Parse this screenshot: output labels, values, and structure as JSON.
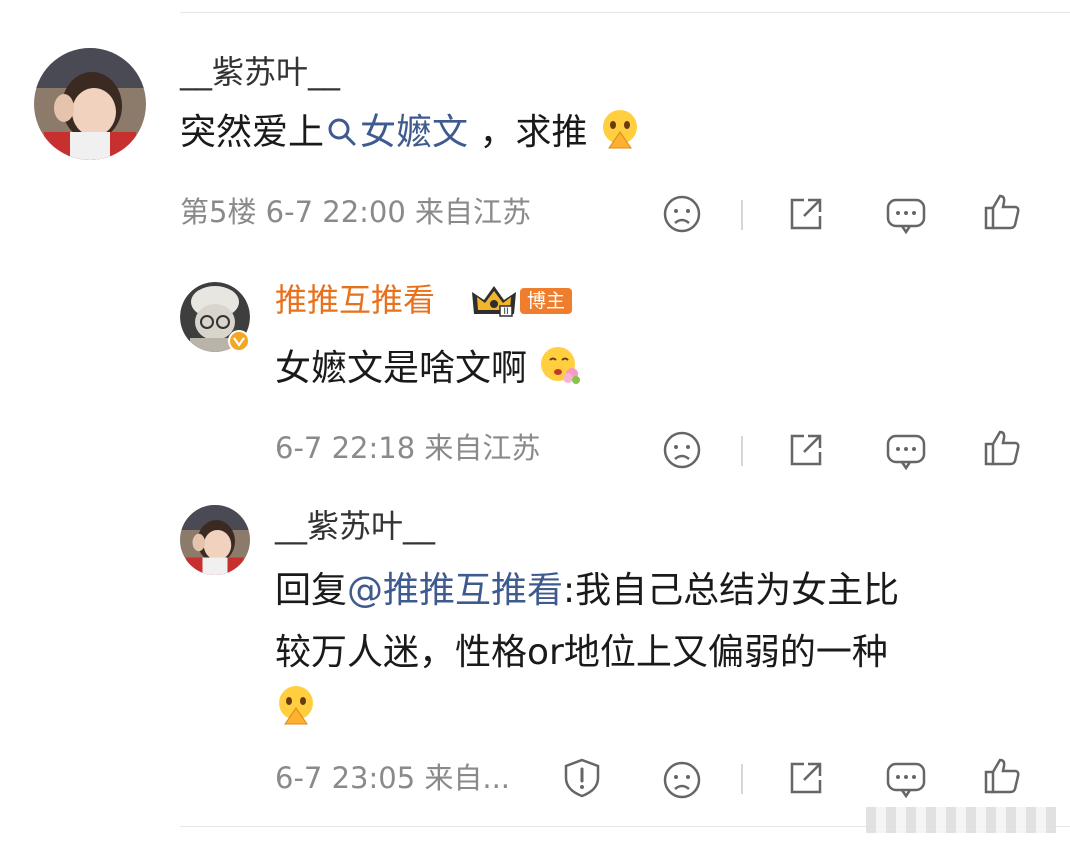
{
  "comments": [
    {
      "username": "__紫苏叶__",
      "text_before": "突然爱上",
      "topic": "女嬷文",
      "text_after": " ，求推",
      "meta": "第5楼 6-7 22:00 来自江苏"
    },
    {
      "username": "推推互推看",
      "badge_label": "博主",
      "text": "女嬷文是啥文啊",
      "meta": "6-7 22:18 来自江苏"
    },
    {
      "username": "__紫苏叶__",
      "reply_prefix": "回复",
      "mention": "@推推互推看",
      "line1": ":我自己总结为女主比",
      "line2": "较万人迷，性格or地位上又偏弱的一种",
      "meta": "6-7 23:05 来自..."
    }
  ],
  "colors": {
    "author_name": "#e8711e",
    "link": "#3f5a8f",
    "meta": "#8a8a8a"
  },
  "icons": [
    "dislike-icon",
    "share-icon",
    "comment-icon",
    "like-icon",
    "report-icon",
    "search-icon",
    "pray-emoji",
    "hug-emoji",
    "crown-icon",
    "verified-icon"
  ]
}
